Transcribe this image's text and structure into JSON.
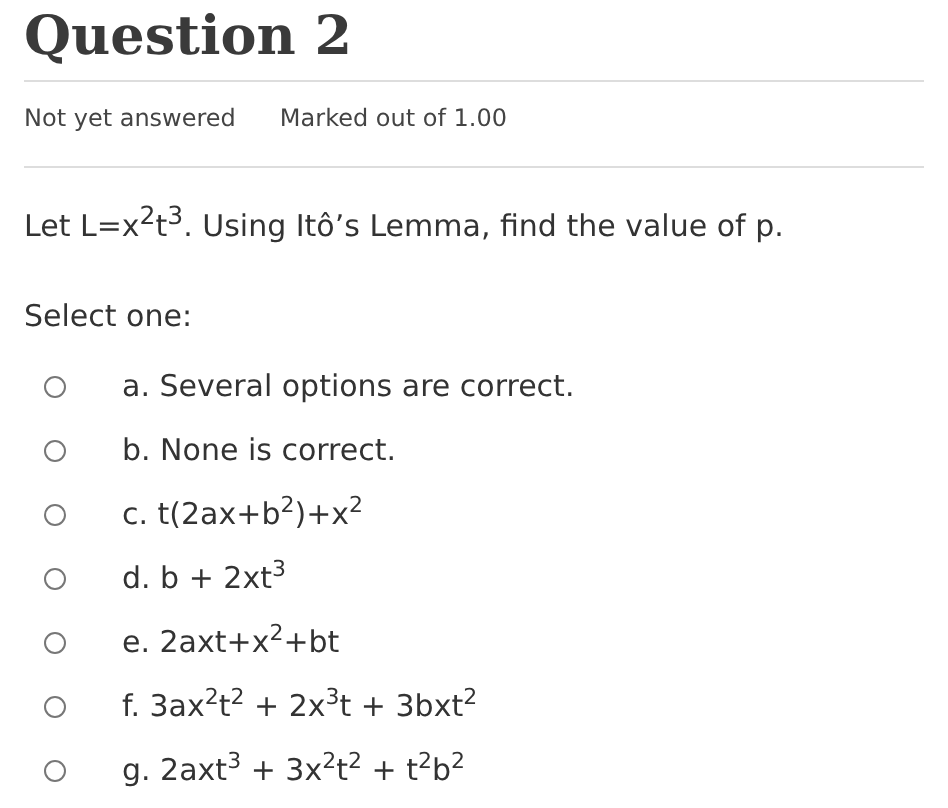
{
  "title": "Question 2",
  "status": "Not yet answered",
  "marks": "Marked out of 1.00",
  "question": "Let L=x$^{2}$t$^{3}$. Using Itô’s Lemma, find the value of p.",
  "prompt": "Select one:",
  "options": [
    {
      "label": "a. Several options are correct.",
      "selected": false
    },
    {
      "label": "b. None is correct.",
      "selected": false
    },
    {
      "label": "c. t(2ax+b$^{2}$)+x$^{2}$",
      "selected": false
    },
    {
      "label": "d. b + 2xt$^{3}$",
      "selected": false
    },
    {
      "label": "e. 2axt+x$^{2}$+bt",
      "selected": false
    },
    {
      "label": "f. 3ax$^{2}$t$^{2}$ + 2x$^{3}$t + 3bxt$^{2}$",
      "selected": false
    },
    {
      "label": "g. 2axt$^{3}$ + 3x$^{2}$t$^{2}$ + t$^{2}$b$^{2}$",
      "selected": false
    }
  ]
}
